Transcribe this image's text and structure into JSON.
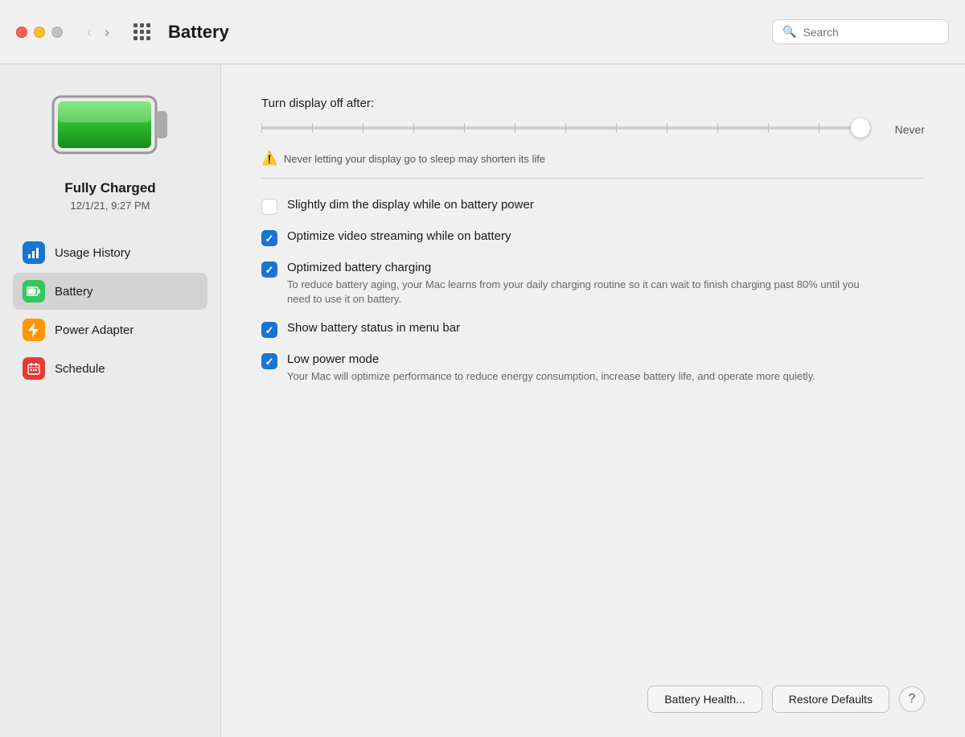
{
  "titlebar": {
    "title": "Battery",
    "search_placeholder": "Search"
  },
  "sidebar": {
    "battery_status": "Fully Charged",
    "battery_timestamp": "12/1/21, 9:27 PM",
    "nav_items": [
      {
        "id": "usage-history",
        "label": "Usage History",
        "icon": "chart",
        "icon_color": "blue",
        "active": false
      },
      {
        "id": "battery",
        "label": "Battery",
        "icon": "battery",
        "icon_color": "green",
        "active": true
      },
      {
        "id": "power-adapter",
        "label": "Power Adapter",
        "icon": "bolt",
        "icon_color": "orange",
        "active": false
      },
      {
        "id": "schedule",
        "label": "Schedule",
        "icon": "calendar",
        "icon_color": "red",
        "active": false
      }
    ]
  },
  "content": {
    "slider_label": "Turn display off after:",
    "slider_value": "Never",
    "slider_warning": "Never letting your display go to sleep may shorten its life",
    "checkboxes": [
      {
        "id": "dim-display",
        "label": "Slightly dim the display while on battery power",
        "sublabel": "",
        "checked": false
      },
      {
        "id": "optimize-video",
        "label": "Optimize video streaming while on battery",
        "sublabel": "",
        "checked": true
      },
      {
        "id": "optimized-charging",
        "label": "Optimized battery charging",
        "sublabel": "To reduce battery aging, your Mac learns from your daily charging routine so it can wait to finish charging past 80% until you need to use it on battery.",
        "checked": true
      },
      {
        "id": "show-status",
        "label": "Show battery status in menu bar",
        "sublabel": "",
        "checked": true
      },
      {
        "id": "low-power",
        "label": "Low power mode",
        "sublabel": "Your Mac will optimize performance to reduce energy consumption, increase battery life, and operate more quietly.",
        "checked": true
      }
    ],
    "buttons": {
      "battery_health": "Battery Health...",
      "restore_defaults": "Restore Defaults",
      "help": "?"
    }
  }
}
